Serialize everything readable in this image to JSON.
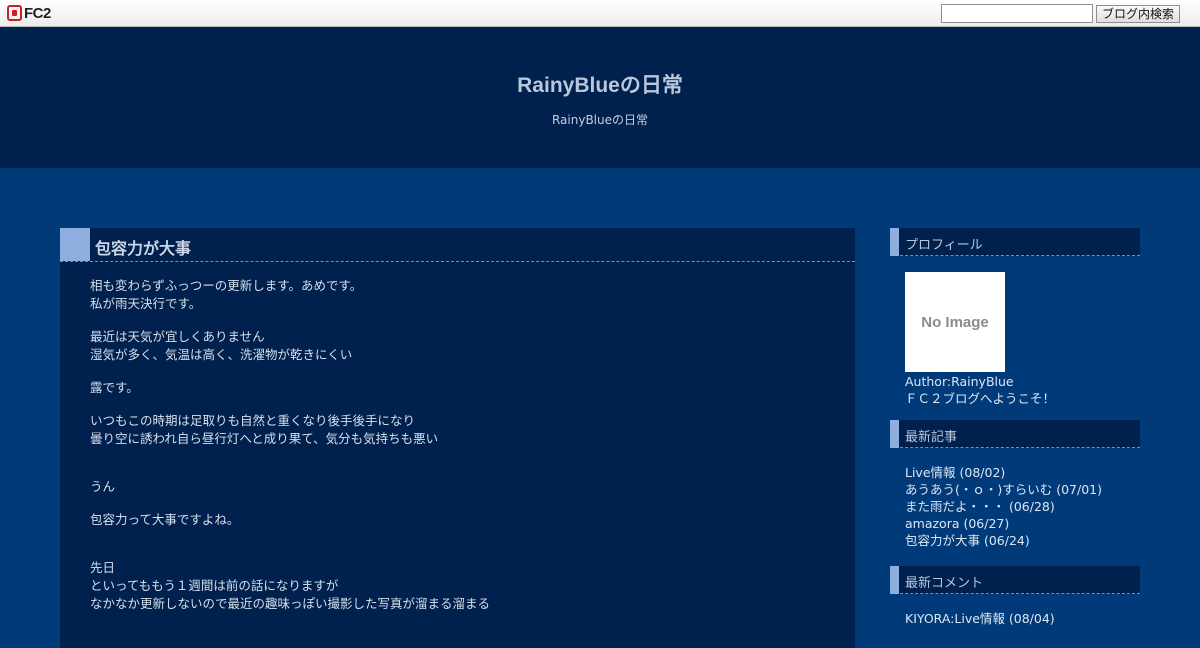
{
  "topbar": {
    "logo_text": "FC2",
    "search_placeholder": "",
    "search_button": "ブログ内検索"
  },
  "header": {
    "title": "RainyBlueの日常",
    "description": "RainyBlueの日常"
  },
  "entry": {
    "title": "包容力が大事",
    "paragraphs": [
      "相も変わらずふっつーの更新します。あめです。",
      "私が雨天決行です。",
      "",
      "最近は天気が宜しくありません",
      "湿気が多く、気温は高く、洗濯物が乾きにくい",
      "",
      "露です。",
      "",
      "いつもこの時期は足取りも自然と重くなり後手後手になり",
      "曇り空に誘われ自ら昼行灯へと成り果て、気分も気持ちも悪い",
      "",
      "",
      "うん",
      "",
      "包容力って大事ですよね。",
      "",
      "",
      "先日",
      "といってももう１週間は前の話になりますが",
      "なかなか更新しないので最近の趣味っぽい撮影した写真が溜まる溜まる"
    ]
  },
  "sidebar": {
    "profile": {
      "title": "プロフィール",
      "image_text": "No Image",
      "author": "Author:RainyBlue",
      "message": "ＦＣ２ブログへようこそ！"
    },
    "recent_posts": {
      "title": "最新記事",
      "items": [
        "Live情報 (08/02)",
        "あうあう(・ｏ・)すらいむ (07/01)",
        "また雨だよ・・・ (06/28)",
        "amazora (06/27)",
        "包容力が大事 (06/24)"
      ]
    },
    "recent_comments": {
      "title": "最新コメント",
      "items": [
        "KIYORA:Live情報 (08/04)"
      ]
    }
  },
  "colors": {
    "page_bg": "#013a78",
    "header_bg": "#00204d",
    "accent": "#8faee0"
  }
}
